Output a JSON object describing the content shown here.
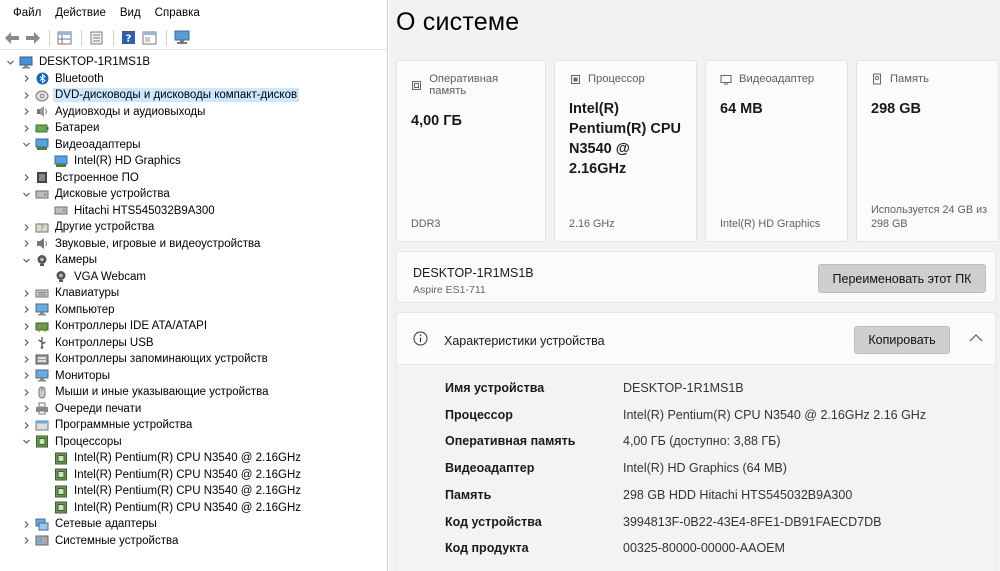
{
  "devmgr": {
    "menu": [
      "Файл",
      "Действие",
      "Вид",
      "Справка"
    ],
    "tree": [
      {
        "label": "DESKTOP-1R1MS1B",
        "level": 0,
        "exp": "open",
        "icon": "computer-icon"
      },
      {
        "label": "Bluetooth",
        "level": 1,
        "exp": "closed",
        "icon": "bluetooth-icon"
      },
      {
        "label": "DVD-дисководы и дисководы компакт-дисков",
        "level": 1,
        "exp": "closed",
        "icon": "dvd-drive-icon",
        "selected": true
      },
      {
        "label": "Аудиовходы и аудиовыходы",
        "level": 1,
        "exp": "closed",
        "icon": "audio-icon"
      },
      {
        "label": "Батареи",
        "level": 1,
        "exp": "closed",
        "icon": "battery-icon"
      },
      {
        "label": "Видеоадаптеры",
        "level": 1,
        "exp": "open",
        "icon": "display-adapter-icon"
      },
      {
        "label": "Intel(R) HD Graphics",
        "level": 2,
        "exp": "none",
        "icon": "display-adapter-icon"
      },
      {
        "label": "Встроенное ПО",
        "level": 1,
        "exp": "closed",
        "icon": "firmware-icon"
      },
      {
        "label": "Дисковые устройства",
        "level": 1,
        "exp": "open",
        "icon": "disk-icon"
      },
      {
        "label": "Hitachi HTS545032B9A300",
        "level": 2,
        "exp": "none",
        "icon": "disk-icon"
      },
      {
        "label": "Другие устройства",
        "level": 1,
        "exp": "closed",
        "icon": "unknown-device-icon"
      },
      {
        "label": "Звуковые, игровые и видеоустройства",
        "level": 1,
        "exp": "closed",
        "icon": "speaker-icon"
      },
      {
        "label": "Камеры",
        "level": 1,
        "exp": "open",
        "icon": "camera-icon"
      },
      {
        "label": "VGA Webcam",
        "level": 2,
        "exp": "none",
        "icon": "camera-icon"
      },
      {
        "label": "Клавиатуры",
        "level": 1,
        "exp": "closed",
        "icon": "keyboard-icon"
      },
      {
        "label": "Компьютер",
        "level": 1,
        "exp": "closed",
        "icon": "monitor-icon"
      },
      {
        "label": "Контроллеры IDE ATA/ATAPI",
        "level": 1,
        "exp": "closed",
        "icon": "controller-icon"
      },
      {
        "label": "Контроллеры USB",
        "level": 1,
        "exp": "closed",
        "icon": "usb-icon"
      },
      {
        "label": "Контроллеры запоминающих устройств",
        "level": 1,
        "exp": "closed",
        "icon": "storage-controller-icon"
      },
      {
        "label": "Мониторы",
        "level": 1,
        "exp": "closed",
        "icon": "monitor-icon"
      },
      {
        "label": "Мыши и иные указывающие устройства",
        "level": 1,
        "exp": "closed",
        "icon": "mouse-icon"
      },
      {
        "label": "Очереди печати",
        "level": 1,
        "exp": "closed",
        "icon": "printer-icon"
      },
      {
        "label": "Программные устройства",
        "level": 1,
        "exp": "closed",
        "icon": "software-device-icon"
      },
      {
        "label": "Процессоры",
        "level": 1,
        "exp": "open",
        "icon": "cpu-icon"
      },
      {
        "label": "Intel(R) Pentium(R) CPU  N3540  @ 2.16GHz",
        "level": 2,
        "exp": "none",
        "icon": "cpu-icon"
      },
      {
        "label": "Intel(R) Pentium(R) CPU  N3540  @ 2.16GHz",
        "level": 2,
        "exp": "none",
        "icon": "cpu-icon"
      },
      {
        "label": "Intel(R) Pentium(R) CPU  N3540  @ 2.16GHz",
        "level": 2,
        "exp": "none",
        "icon": "cpu-icon"
      },
      {
        "label": "Intel(R) Pentium(R) CPU  N3540  @ 2.16GHz",
        "level": 2,
        "exp": "none",
        "icon": "cpu-icon"
      },
      {
        "label": "Сетевые адаптеры",
        "level": 1,
        "exp": "closed",
        "icon": "network-icon"
      },
      {
        "label": "Системные устройства",
        "level": 1,
        "exp": "closed",
        "icon": "system-device-icon"
      }
    ]
  },
  "settings": {
    "title": "О системе",
    "cards": [
      {
        "name": "ram",
        "icon": "memory-icon",
        "label": "Оперативная память",
        "value": "4,00 ГБ",
        "sub": "DDR3"
      },
      {
        "name": "cpu",
        "icon": "processor-icon",
        "label": "Процессор",
        "value": "Intel(R) Pentium(R) CPU N3540  @ 2.16GHz",
        "sub": "2.16 GHz"
      },
      {
        "name": "gpu",
        "icon": "gpu-icon",
        "label": "Видеоадаптер",
        "value": "64 MB",
        "sub": "Intel(R) HD Graphics"
      },
      {
        "name": "storage",
        "icon": "storage-icon",
        "label": "Память",
        "value": "298 GB",
        "sub": "Используется 24 GB из 298 GB"
      }
    ],
    "pc": {
      "name": "DESKTOP-1R1MS1B",
      "model": "Aspire ES1-711",
      "rename_label": "Переименовать этот ПК"
    },
    "specs": {
      "title": "Характеристики устройства",
      "copy_label": "Копировать",
      "rows": [
        {
          "k": "Имя устройства",
          "v": "DESKTOP-1R1MS1B"
        },
        {
          "k": "Процессор",
          "v": "Intel(R) Pentium(R) CPU  N3540  @ 2.16GHz   2.16 GHz"
        },
        {
          "k": "Оперативная память",
          "v": "4,00 ГБ (доступно: 3,88 ГБ)"
        },
        {
          "k": "Видеоадаптер",
          "v": "Intel(R) HD Graphics (64 MB)"
        },
        {
          "k": "Память",
          "v": "298 GB HDD Hitachi HTS545032B9A300"
        },
        {
          "k": "Код устройства",
          "v": "3994813F-0B22-43E4-8FE1-DB91FAECD7DB"
        },
        {
          "k": "Код продукта",
          "v": "00325-80000-00000-AAOEM"
        }
      ]
    }
  }
}
